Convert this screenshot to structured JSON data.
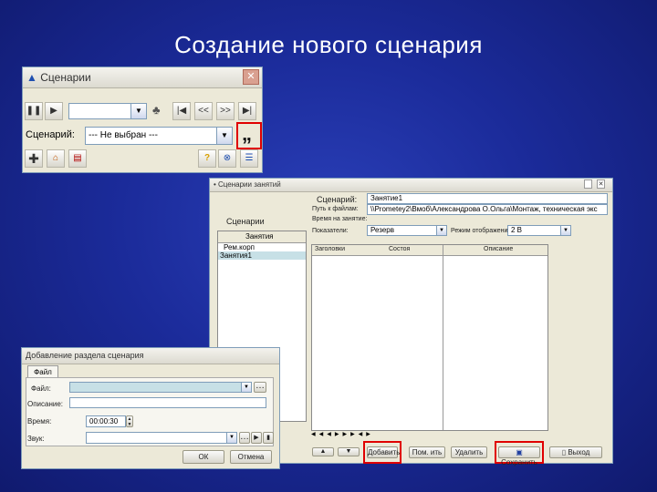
{
  "slide_title": "Создание нового сценария",
  "scenario_window": {
    "title": "Сценарии",
    "close_glyph": "✕",
    "scenario_label": "Сценарий:",
    "scenario_value": "--- Не выбран ---",
    "quote_button": "„",
    "media_buttons": [
      "❚❚",
      "▶",
      "|◀",
      "<<",
      ">>",
      "▶|"
    ]
  },
  "lessons_window": {
    "title": "• Сценарии занятий",
    "section_label": "Сценарии",
    "tree_header": "Занятия",
    "tree_items": [
      "Рем.корп",
      "Занятия1"
    ],
    "scenario_label": "Сценарий:",
    "scenario_value": "Занятие1",
    "path_label": "Путь к файлам:",
    "path_value": "\\\\Prometey2\\Вмоб\\Александрова О.Ольга\\Монтаж, техническая экс",
    "duration_label": "Время на занятие:",
    "condition_label": "Показатели:",
    "condition_value": "Резерв",
    "mode_label": "Режим отображения:",
    "mode_value": "2 В",
    "columns": [
      "Заголовки",
      "Состоя",
      "Описание"
    ],
    "buttons": {
      "add": "Добавить",
      "edit": "Пом. ить",
      "delete": "Удалить",
      "save": "Сохранить",
      "exit": "Выход"
    }
  },
  "add_section_dialog": {
    "title": "Добавление раздела сценария",
    "tab": "Файл",
    "file_label": "Файл:",
    "description_label": "Описание:",
    "time_label": "Время:",
    "time_value": "00:00:30",
    "sound_label": "Звук:",
    "ok": "ОК",
    "cancel": "Отмена"
  },
  "colors": {
    "highlight": "#e00000",
    "selection": "#c7e0e6",
    "slide_bg": "#1b2b9a"
  }
}
